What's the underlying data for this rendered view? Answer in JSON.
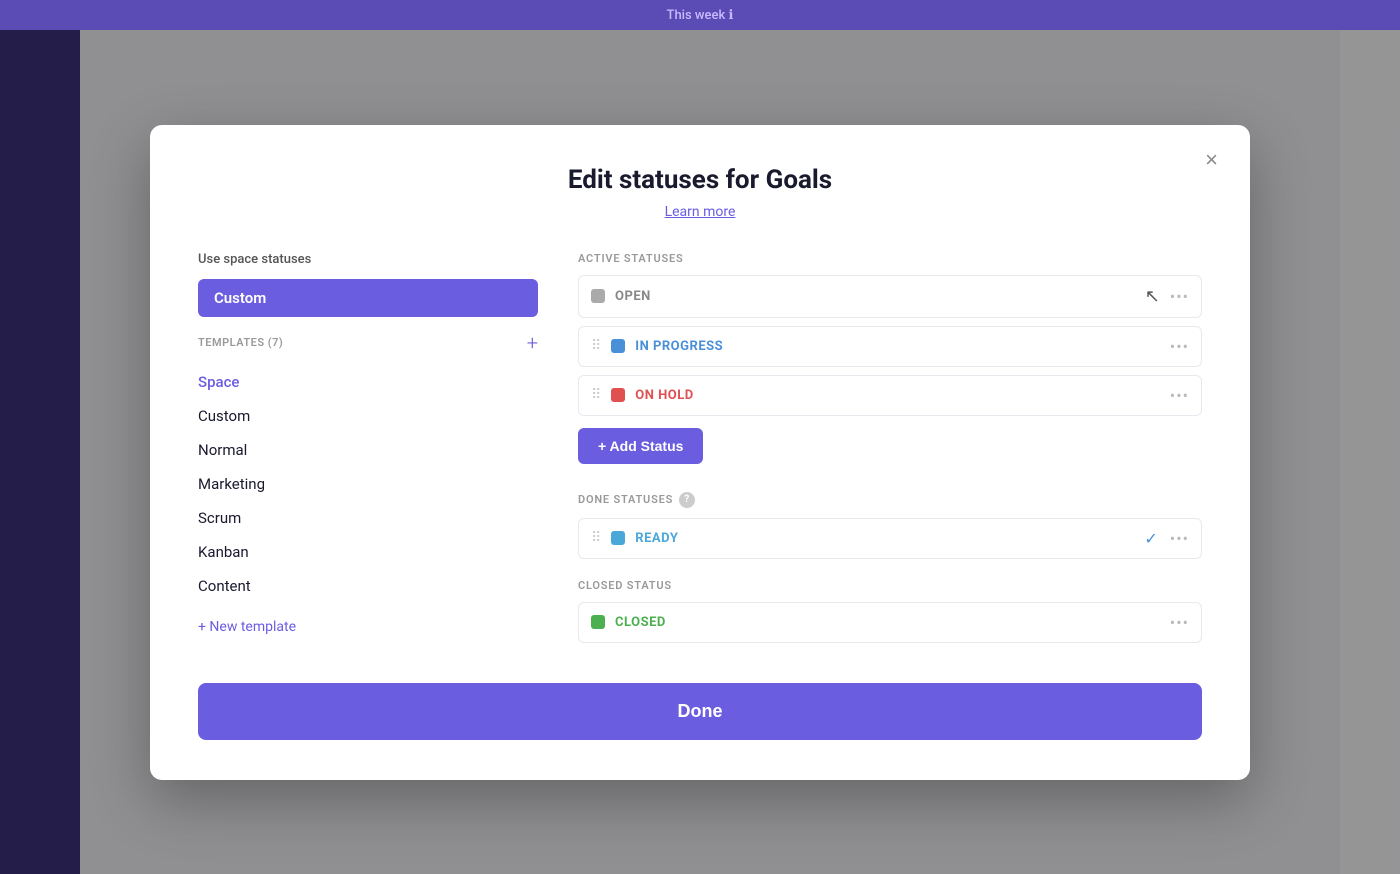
{
  "topbar": {
    "title": "This week",
    "info_icon": "ℹ"
  },
  "modal": {
    "title": "Edit statuses for Goals",
    "learn_more": "Learn more",
    "close_label": "×",
    "left": {
      "use_space_label": "Use space statuses",
      "custom_selected": "Custom",
      "templates_header": "TEMPLATES (7)",
      "add_icon": "+",
      "templates": [
        {
          "label": "Space",
          "active": true
        },
        {
          "label": "Custom"
        },
        {
          "label": "Normal"
        },
        {
          "label": "Marketing"
        },
        {
          "label": "Scrum"
        },
        {
          "label": "Kanban"
        },
        {
          "label": "Content"
        }
      ],
      "new_template": "+ New template"
    },
    "right": {
      "active_section": "ACTIVE STATUSES",
      "active_statuses": [
        {
          "name": "OPEN",
          "color": "gray",
          "dot": "gray",
          "has_drag": false
        },
        {
          "name": "IN PROGRESS",
          "color": "blue",
          "dot": "blue",
          "has_drag": true
        },
        {
          "name": "ON HOLD",
          "color": "red",
          "dot": "red",
          "has_drag": true
        }
      ],
      "add_status_label": "+ Add Status",
      "done_section": "DONE STATUSES",
      "done_statuses": [
        {
          "name": "READY",
          "color": "blue-teal",
          "dot": "blue-teal",
          "has_drag": true,
          "has_check": true
        }
      ],
      "closed_section": "CLOSED STATUS",
      "closed_statuses": [
        {
          "name": "CLOSED",
          "color": "green",
          "dot": "green",
          "has_drag": false
        }
      ]
    },
    "done_button": "Done"
  }
}
